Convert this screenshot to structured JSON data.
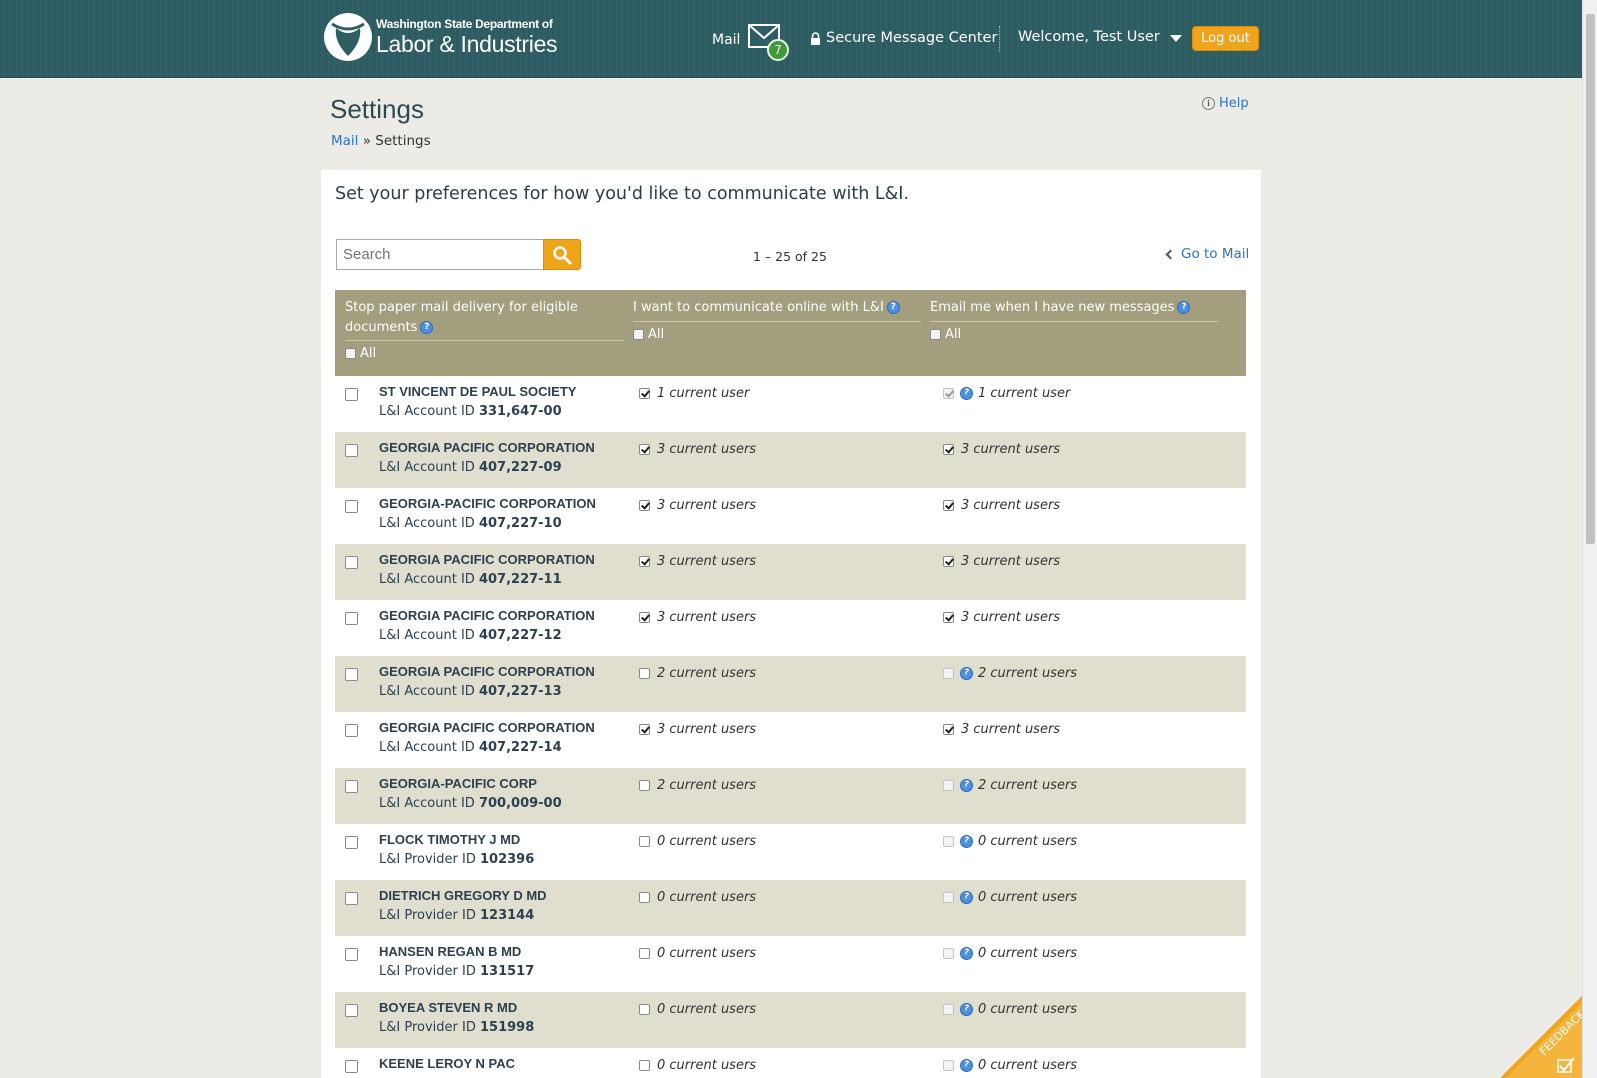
{
  "header": {
    "logo_line1": "Washington State Department of",
    "logo_line2": "Labor & Industries",
    "mail_label": "Mail",
    "mail_count": "7",
    "secure_label": "Secure Message Center",
    "welcome_label": "Welcome, Test User",
    "logout_label": "Log out"
  },
  "page": {
    "title": "Settings",
    "help_label": "Help",
    "breadcrumb_mail": "Mail",
    "breadcrumb_sep": " » ",
    "breadcrumb_current": "Settings"
  },
  "content": {
    "intro": "Set your preferences for how you'd like to communicate with L&I.",
    "search_placeholder": "Search",
    "pager": "1 – 25 of 25",
    "goto_mail": "Go to Mail"
  },
  "table": {
    "col1_title": "Stop paper mail delivery for eligible documents",
    "col2_title": "I want to communicate online with L&I",
    "col3_title": "Email me when I have new messages",
    "all_label": "All",
    "rows": [
      {
        "name": "ST VINCENT DE PAUL SOCIETY",
        "id_label": "L&I Account ID",
        "id": "331,647-00",
        "online": "1 current user",
        "email": "1 current user"
      },
      {
        "name": "GEORGIA PACIFIC CORPORATION",
        "id_label": "L&I Account ID",
        "id": "407,227-09",
        "online": "3 current users",
        "email": "3 current users"
      },
      {
        "name": "GEORGIA-PACIFIC CORPORATION",
        "id_label": "L&I Account ID",
        "id": "407,227-10",
        "online": "3 current users",
        "email": "3 current users"
      },
      {
        "name": "GEORGIA PACIFIC CORPORATION",
        "id_label": "L&I Account ID",
        "id": "407,227-11",
        "online": "3 current users",
        "email": "3 current users"
      },
      {
        "name": "GEORGIA PACIFIC CORPORATION",
        "id_label": "L&I Account ID",
        "id": "407,227-12",
        "online": "3 current users",
        "email": "3 current users"
      },
      {
        "name": "GEORGIA PACIFIC CORPORATION",
        "id_label": "L&I Account ID",
        "id": "407,227-13",
        "online": "2 current users",
        "email": "2 current users"
      },
      {
        "name": "GEORGIA PACIFIC CORPORATION",
        "id_label": "L&I Account ID",
        "id": "407,227-14",
        "online": "3 current users",
        "email": "3 current users"
      },
      {
        "name": "GEORGIA-PACIFIC CORP",
        "id_label": "L&I Account ID",
        "id": "700,009-00",
        "online": "2 current users",
        "email": "2 current users"
      },
      {
        "name": "FLOCK TIMOTHY J MD",
        "id_label": "L&I Provider ID",
        "id": "102396",
        "online": "0 current users",
        "email": "0 current users"
      },
      {
        "name": "DIETRICH GREGORY D MD",
        "id_label": "L&I Provider ID",
        "id": "123144",
        "online": "0 current users",
        "email": "0 current users"
      },
      {
        "name": "HANSEN REGAN B MD",
        "id_label": "L&I Provider ID",
        "id": "131517",
        "online": "0 current users",
        "email": "0 current users"
      },
      {
        "name": "BOYEA STEVEN R MD",
        "id_label": "L&I Provider ID",
        "id": "151998",
        "online": "0 current users",
        "email": "0 current users"
      },
      {
        "name": "KEENE LEROY N PAC",
        "id_label": "",
        "id": "",
        "online": "0 current users",
        "email": "0 current users"
      }
    ]
  },
  "feedback_label": "FEEDBACK",
  "colors": {
    "header_bg": "#2c5c61",
    "accent_orange": "#f0a41c",
    "table_header": "#a39e7e",
    "row_alt": "#dfdecf",
    "link_blue": "#2a75c5"
  }
}
